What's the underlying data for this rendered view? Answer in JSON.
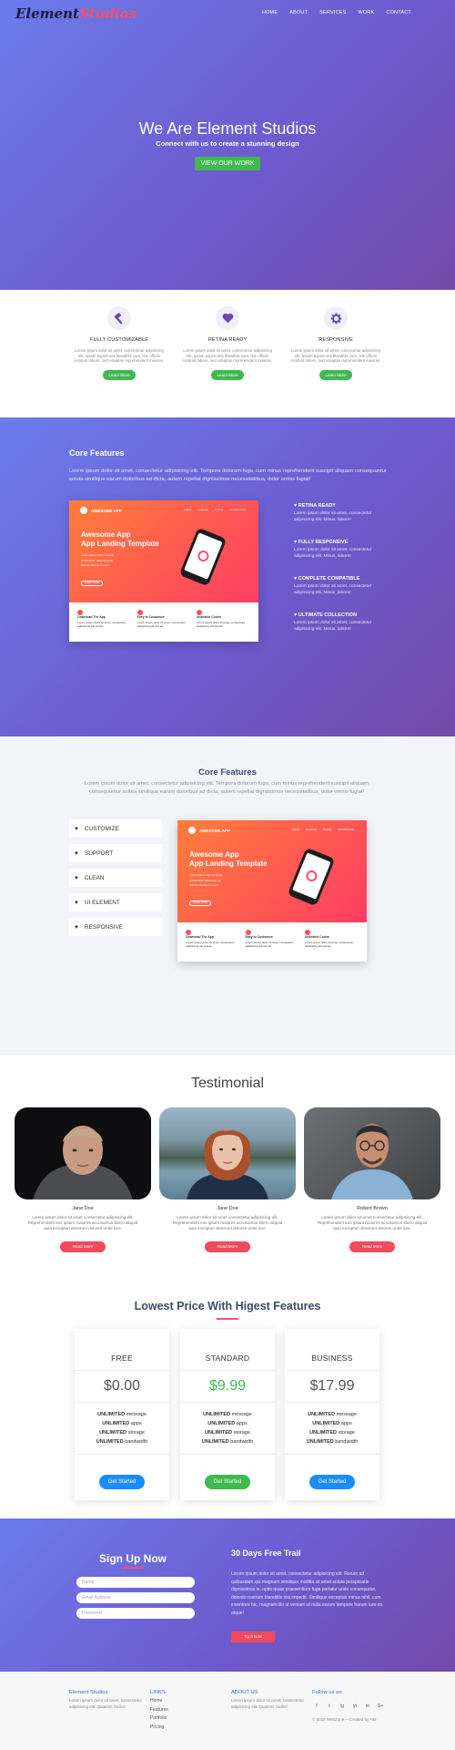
{
  "brand": {
    "part1": "Element",
    "part2": "Studios"
  },
  "nav": [
    "HOME",
    "ABOUT",
    "SERVICES",
    "WORK",
    "CONTACT"
  ],
  "hero": {
    "title": "We Are Element Studios",
    "subtitle": "Connect with us to create a stunning design",
    "button": "VIEW OUR WORK"
  },
  "features3": [
    {
      "icon": "hammer-icon",
      "title": "FULLY CUSTOMIZABLE",
      "text": "Lorem ipsum dolor sit amet, consectetur adipisicing elit. Ipsam asperiores blanditiis cum, iste officiis incidunt labore, sed voluptas reprehenderit maiores.",
      "button": "Learn More"
    },
    {
      "icon": "heart-icon",
      "title": "RETINA READY",
      "text": "Lorem ipsum dolor sit amet, consectetur adipisicing elit. Ipsam asperiores blanditiis cum, iste officiis incidunt labore, sed voluptas reprehenderit maiores.",
      "button": "Learn More"
    },
    {
      "icon": "gear-icon",
      "title": "RESPONSIVE",
      "text": "Lorem ipsum dolor sit amet, consectetur adipisicing elit. Ipsam asperiores blanditiis cum, iste officiis incidunt labore, sed voluptas reprehenderit maiores.",
      "button": "Learn More"
    }
  ],
  "core1": {
    "title": "Core Features",
    "text": "Lorem ipsum dolor sit amet, consectetur adipisicing elit. Tempora dolorum fuga, cum minus reprehenderit suscipit aliquam consequuntur soluta similique earum doloribus ad dicta, autem repellat dignissimos necessitatibus, dolor omnis fugiat!",
    "items": [
      {
        "title": "RETINA READY",
        "text": "Lorem ipsum dolor sit amet, consectetur adipisicing elit. Minus, labore!"
      },
      {
        "title": "FULLY RESPONSIVE",
        "text": "Lorem ipsum dolor sit amet, consectetur adipisicing elit. Minus, labore!"
      },
      {
        "title": "COMPLETE COMPATIBLE",
        "text": "Lorem ipsum dolor sit amet, consectetur adipisicing elit. Minus, labore!"
      },
      {
        "title": "ULTIMATE COLLECTION",
        "text": "Lorem ipsum dolor sit amet, consectetur adipisicing elit. Minus, labore!"
      }
    ]
  },
  "mock": {
    "logo": "AWESOME APP",
    "nav": [
      "Home",
      "Features",
      "Pricing",
      "DOWNLOAD"
    ],
    "headline1": "Awesome App",
    "headline2": "App Landing Template",
    "bullets": [
      "Lorem ipsum dolor sit amet",
      "Consectetur adipiscing elit",
      "Sed do eiusmod tempor",
      "Incididunt ut labore"
    ],
    "button": "LEARN MORE",
    "features": [
      {
        "title": "Download The App",
        "text": "Lorem ipsum dolor sit amet, consectetur adipisicing elit sed do"
      },
      {
        "title": "Easy to Customize",
        "text": "Lorem ipsum dolor sit amet, consectetur adipisicing elit sed do"
      },
      {
        "title": "Unlimited Colors",
        "text": "Lorem ipsum dolor sit amet, consectetur adipisicing elit sed do"
      }
    ]
  },
  "core2": {
    "title": "Core Features",
    "text": "Lorem ipsum dolor sit amet, consectetur adipisicing elit. Tempora dolorum fuga, cum minus reprehenderit suscipit aliquam consequuntur soluta similique earum doloribus ad dicta, autem repellat dignissimos necessitatibus, dolor omnis fugiat!",
    "items": [
      "CUSTOMIZE",
      "SUPPORT",
      "CLEAN",
      "UI ELEMENT",
      "RESPONSIVE"
    ]
  },
  "testimonial": {
    "title": "Testimonial",
    "people": [
      {
        "name": "Jane Doe",
        "text": "Lorem ipsum dolor sit amet consectetur adipisicing elit. Reprehenderit eos ipsam maiores accusamus libero aliquid quia excepturi deserunt dolores unde iure.",
        "button": "Read More"
      },
      {
        "name": "Jane Doe",
        "text": "Lorem ipsum dolor sit amet consectetur adipisicing elit. Reprehenderit eos ipsam maiores accusamus libero aliquid quia excepturi deserunt dolores unde iure.",
        "button": "Read More"
      },
      {
        "name": "Robert Brown",
        "text": "Lorem ipsum dolor sit amet consectetur adipisicing elit. Reprehenderit eos ipsam maiores accusamus libero aliquid quia excepturi deserunt dolores unde iure.",
        "button": "Read More"
      }
    ]
  },
  "pricing": {
    "title": "Lowest Price With Higest Features",
    "plans": [
      {
        "name": "FREE",
        "price": "$0.00",
        "color": "#1a8cff",
        "btn": "Get Started"
      },
      {
        "name": "STANDARD",
        "price": "$9.99",
        "color": "#3fb950",
        "btn": "Get Started"
      },
      {
        "name": "BUSINESS",
        "price": "$17.99",
        "color": "#1a8cff",
        "btn": "Get Started"
      }
    ],
    "features": [
      {
        "bold": "UNLIMITED",
        "rest": "message"
      },
      {
        "bold": "UNLIMITED",
        "rest": "apps"
      },
      {
        "bold": "UNLIMITED",
        "rest": "storage"
      },
      {
        "bold": "UNLIMITED",
        "rest": "bandwidth"
      }
    ]
  },
  "signup": {
    "title": "Sign Up Now",
    "name_ph": "Name",
    "email_ph": "Email Address",
    "pass_ph": "Password",
    "trial_title": "30 Days Free Trail",
    "trial_text": "Lorem ipsum dolor sit amet, consectetur adipisicing elit. Rerum ad quibusdam qui magnam similique mollitia sit amet soluta perspiciatis dignissimos in, optio quasi praesentium fuga pariatur unde consequatur, deleniti nostrum blanditiis nisi impedit. Similique excepturi minus nihil, cum inventore hic, magnam illo ut veniam ut nulla earum tempore harum iure ea atque!",
    "trial_btn": "Try It Now"
  },
  "footer": {
    "col1_title": "Element Studios",
    "col1_text": "Lorem ipsum dolor sit amet, consectetur adipisicing elit. Quaerat, facilis!",
    "col2_title": "LINKS",
    "links": [
      "Home",
      "Features",
      "Portfolio",
      "Pricing"
    ],
    "col3_title": "ABOUT US",
    "col3_text": "Lorem ipsum dolor sit amet, consectetur adipisicing elit. Quaerat, facilis!",
    "col4_title": "Follow us on",
    "social": [
      "f",
      "t",
      "ig",
      "yt",
      "in",
      "G+"
    ],
    "copyright": "© 2018 WebZone – Created by HM"
  }
}
